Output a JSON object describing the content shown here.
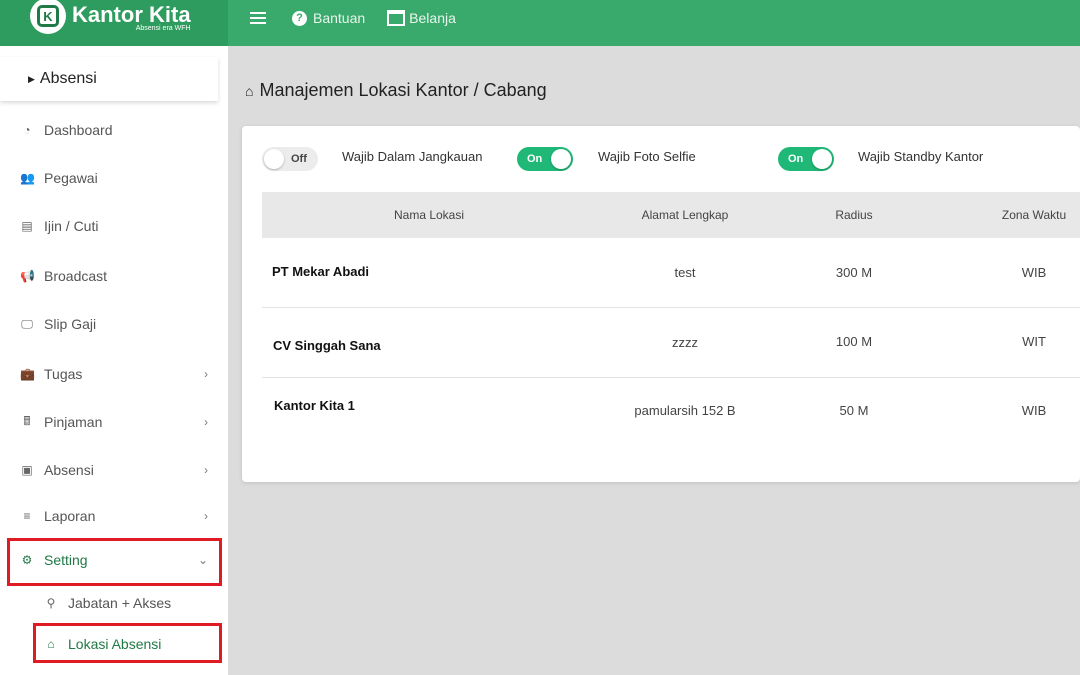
{
  "brand": {
    "title": "Kantor Kita",
    "subtitle": "Absensi era WFH",
    "logo_letter": "K"
  },
  "topbar": {
    "help_label": "Bantuan",
    "shop_label": "Belanja"
  },
  "sidebar": {
    "section_label": "Absensi",
    "items": [
      {
        "label": "Dashboard",
        "icon": "gauge-icon",
        "glyph": "◔",
        "chevron": ""
      },
      {
        "label": "Pegawai",
        "icon": "people-icon",
        "glyph": "👥",
        "chevron": ""
      },
      {
        "label": "Ijin / Cuti",
        "icon": "document-icon",
        "glyph": "▤",
        "chevron": ""
      },
      {
        "label": "Broadcast",
        "icon": "megaphone-icon",
        "glyph": "📢",
        "chevron": ""
      },
      {
        "label": "Slip Gaji",
        "icon": "monitor-icon",
        "glyph": "🖵",
        "chevron": ""
      },
      {
        "label": "Tugas",
        "icon": "briefcase-icon",
        "glyph": "💼",
        "chevron": "›"
      },
      {
        "label": "Pinjaman",
        "icon": "calculator-icon",
        "glyph": "🖩",
        "chevron": "›"
      },
      {
        "label": "Absensi",
        "icon": "id-card-icon",
        "glyph": "▣",
        "chevron": "›"
      },
      {
        "label": "Laporan",
        "icon": "database-icon",
        "glyph": "≡",
        "chevron": "›"
      },
      {
        "label": "Setting",
        "icon": "gears-icon",
        "glyph": "⚙",
        "chevron": "⌄"
      }
    ],
    "sub_items": [
      {
        "label": "Jabatan + Akses",
        "icon": "org-chart-icon",
        "glyph": "⚲"
      },
      {
        "label": "Lokasi Absensi",
        "icon": "home-icon",
        "glyph": "⌂"
      }
    ]
  },
  "page": {
    "title": "Manajemen Lokasi Kantor / Cabang"
  },
  "toggles": [
    {
      "state": "Off",
      "caption": "Wajib Dalam Jangkauan"
    },
    {
      "state": "On",
      "caption": "Wajib Foto Selfie"
    },
    {
      "state": "On",
      "caption": "Wajib Standby Kantor"
    }
  ],
  "table": {
    "columns": [
      "Nama Lokasi",
      "Alamat Lengkap",
      "Radius",
      "Zona Waktu"
    ],
    "rows": [
      {
        "name": "PT Mekar Abadi",
        "address": "test",
        "radius": "300 M",
        "zone": "WIB"
      },
      {
        "name": "CV Singgah Sana",
        "address": "zzzz",
        "radius": "100 M",
        "zone": "WIT"
      },
      {
        "name": "Kantor Kita 1",
        "address": "pamularsih 152 B",
        "radius": "50 M",
        "zone": "WIB"
      }
    ]
  },
  "colors": {
    "brand_dark": "#2e9c5e",
    "topbar": "#3aaa6c",
    "toggle_on": "#1fb877",
    "highlight": "#e01b24"
  }
}
